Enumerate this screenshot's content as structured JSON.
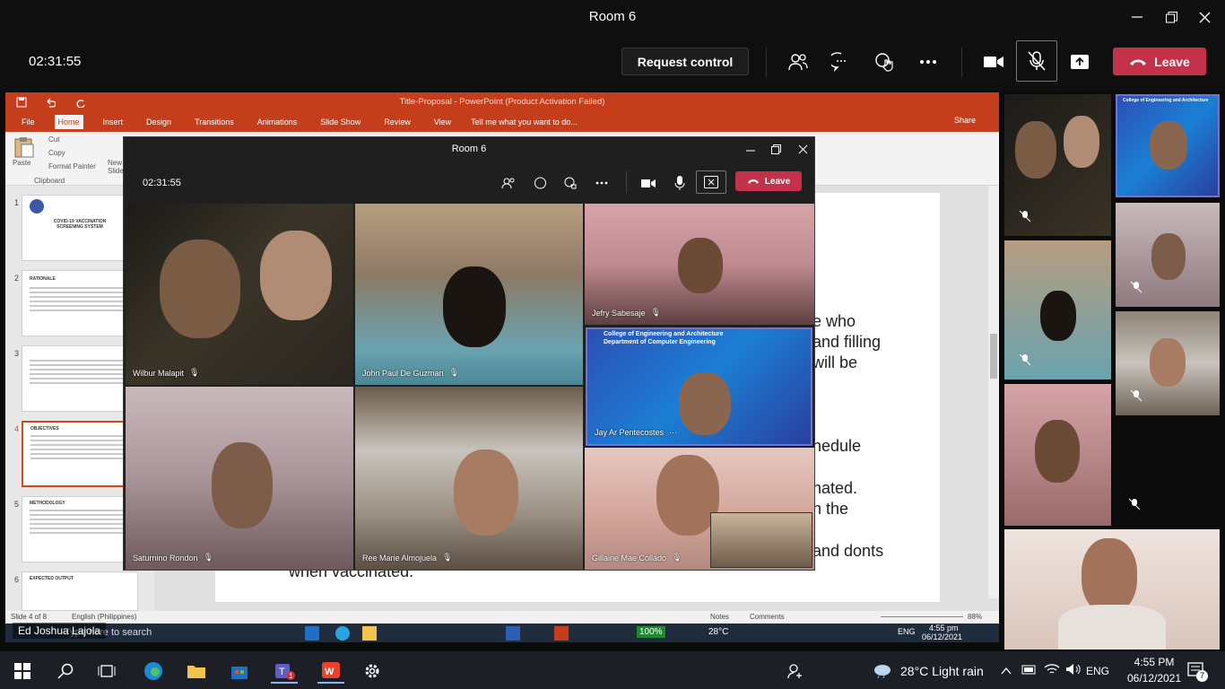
{
  "window": {
    "title": "Room 6"
  },
  "toolbar": {
    "timer": "02:31:55",
    "request_control": "Request control",
    "leave": "Leave"
  },
  "ppt": {
    "title": "Title-Proposal - PowerPoint (Product Activation Failed)",
    "tabs": [
      "File",
      "Home",
      "Insert",
      "Design",
      "Transitions",
      "Animations",
      "Slide Show",
      "Review",
      "View"
    ],
    "tell_me": "Tell me what you want to do...",
    "share": "Share",
    "ribbon": {
      "paste": "Paste",
      "cut": "Cut",
      "copy": "Copy",
      "format_painter": "Format Painter",
      "clipboard": "Clipboard",
      "new_slide": "New Slide"
    },
    "thumb_numbers": [
      "1",
      "2",
      "3",
      "4",
      "5",
      "6"
    ],
    "thumb1_title": "COVID-19 VACCINATION SCREENING SYSTEM",
    "thumb2_head": "RATIONALE",
    "thumb4_head": "OBJECTIVES",
    "thumb5_head": "METHODOLOGY",
    "thumb6_head": "EXPECTED OUTPUT",
    "slide_lines": [
      "e who",
      "and filling",
      "will be",
      "hedule",
      "nated.",
      "n the",
      "and donts",
      "when vaccinated."
    ],
    "status": {
      "slide": "Slide 4 of 8",
      "language": "English (Philippines)",
      "notes": "Notes",
      "comments": "Comments",
      "zoom": "88%"
    }
  },
  "popout": {
    "title": "Room 6",
    "timer": "02:31:55",
    "leave": "Leave",
    "participants": [
      {
        "name": "Wilbur Malapit"
      },
      {
        "name": "John Paul De Guzman"
      },
      {
        "name": "Jefry Sabesaje"
      },
      {
        "name": "Jay Ar Pentecostes"
      },
      {
        "name": "Saturnino Rondon"
      },
      {
        "name": "Ree Marie Almojuela"
      },
      {
        "name": "Gillaine Mae Collado"
      }
    ],
    "jay_banner": "College of Engineering and Architecture",
    "jay_banner2": "Department of Computer Engineering"
  },
  "gallery": {
    "presenter_banner": "College of Engineering and Architecture"
  },
  "self_view": {
    "name": "Ed Joshua Lajola"
  },
  "inner_taskbar": {
    "search": "Type here to search",
    "battery": "100%",
    "weather": "28°C",
    "lang": "ENG",
    "time": "4:55 pm",
    "date": "06/12/2021"
  },
  "taskbar": {
    "weather": "28°C  Light rain",
    "lang": "ENG",
    "time": "4:55 PM",
    "date": "06/12/2021",
    "notifications": "7"
  },
  "colors": {
    "teams_red": "#c4314b",
    "ppt_orange": "#c43e1c",
    "highlight": "#6b74d8"
  }
}
